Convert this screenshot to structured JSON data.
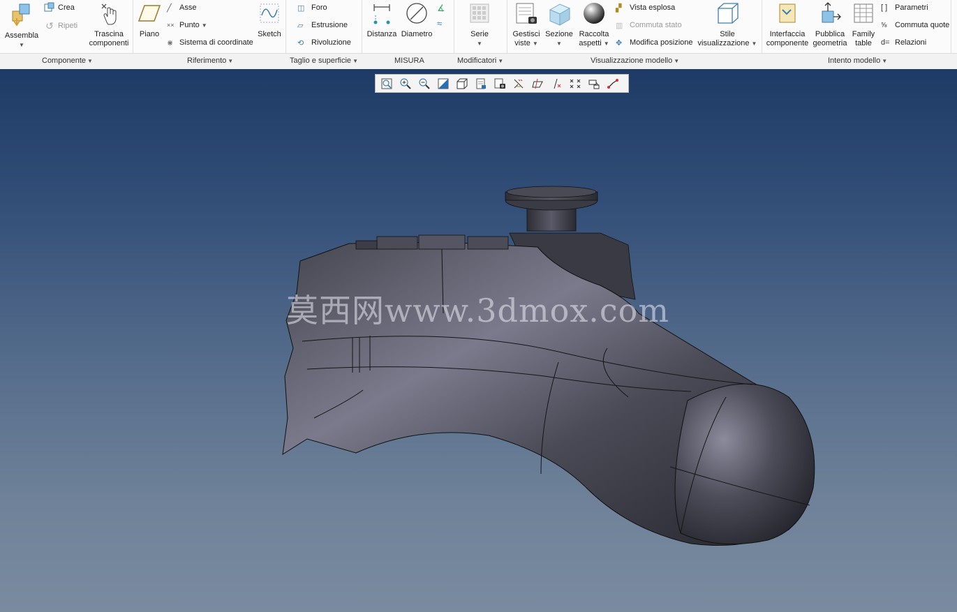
{
  "ribbon": {
    "componente": {
      "assembla": "Assembla",
      "crea": "Crea",
      "ripeti": "Ripeti",
      "trascina": [
        "Trascina",
        "componenti"
      ],
      "group": "Componente"
    },
    "riferimento": {
      "piano": "Piano",
      "asse": "Asse",
      "punto": "Punto",
      "sistema": "Sistema di coordinate",
      "sketch": "Sketch",
      "group": "Riferimento"
    },
    "taglio": {
      "foro": "Foro",
      "estrusione": "Estrusione",
      "rivoluzione": "Rivoluzione",
      "group": "Taglio e superficie"
    },
    "misura": {
      "distanza": "Distanza",
      "diametro": "Diametro",
      "group": "MISURA"
    },
    "modificatori": {
      "serie": "Serie",
      "group": "Modificatori"
    },
    "visualizzazione": {
      "gestisci": [
        "Gestisci",
        "viste"
      ],
      "sezione": "Sezione",
      "raccolta": [
        "Raccolta",
        "aspetti"
      ],
      "vista_esplosa": "Vista esplosa",
      "commuta_stato": "Commuta stato",
      "modifica_posizione": "Modifica posizione",
      "stile": [
        "Stile",
        "visualizzazione"
      ],
      "group": "Visualizzazione modello"
    },
    "intento": {
      "interfaccia": [
        "Interfaccia",
        "componente"
      ],
      "pubblica": [
        "Pubblica",
        "geometria"
      ],
      "family": [
        "Family",
        "table"
      ],
      "parametri": "Parametri",
      "commuta_quote": "Commuta quote",
      "relazioni": "Relazioni",
      "group": "Intento modello"
    }
  },
  "view_toolbar": {
    "icons": [
      "refit-icon",
      "zoom-in-icon",
      "zoom-out-icon",
      "repaint-icon",
      "display-style-icon",
      "saved-views-icon",
      "view-manager-icon",
      "plane-display-icon",
      "axis-display-icon",
      "point-display-icon",
      "csys-display-icon",
      "annotation-display-icon",
      "spin-center-icon"
    ]
  },
  "watermark": "莫西网www.3dmox.com",
  "colors": {
    "viewport_top": "#1d3b66",
    "viewport_bottom": "#7a8ba0",
    "model_body": "#3a3a44"
  }
}
